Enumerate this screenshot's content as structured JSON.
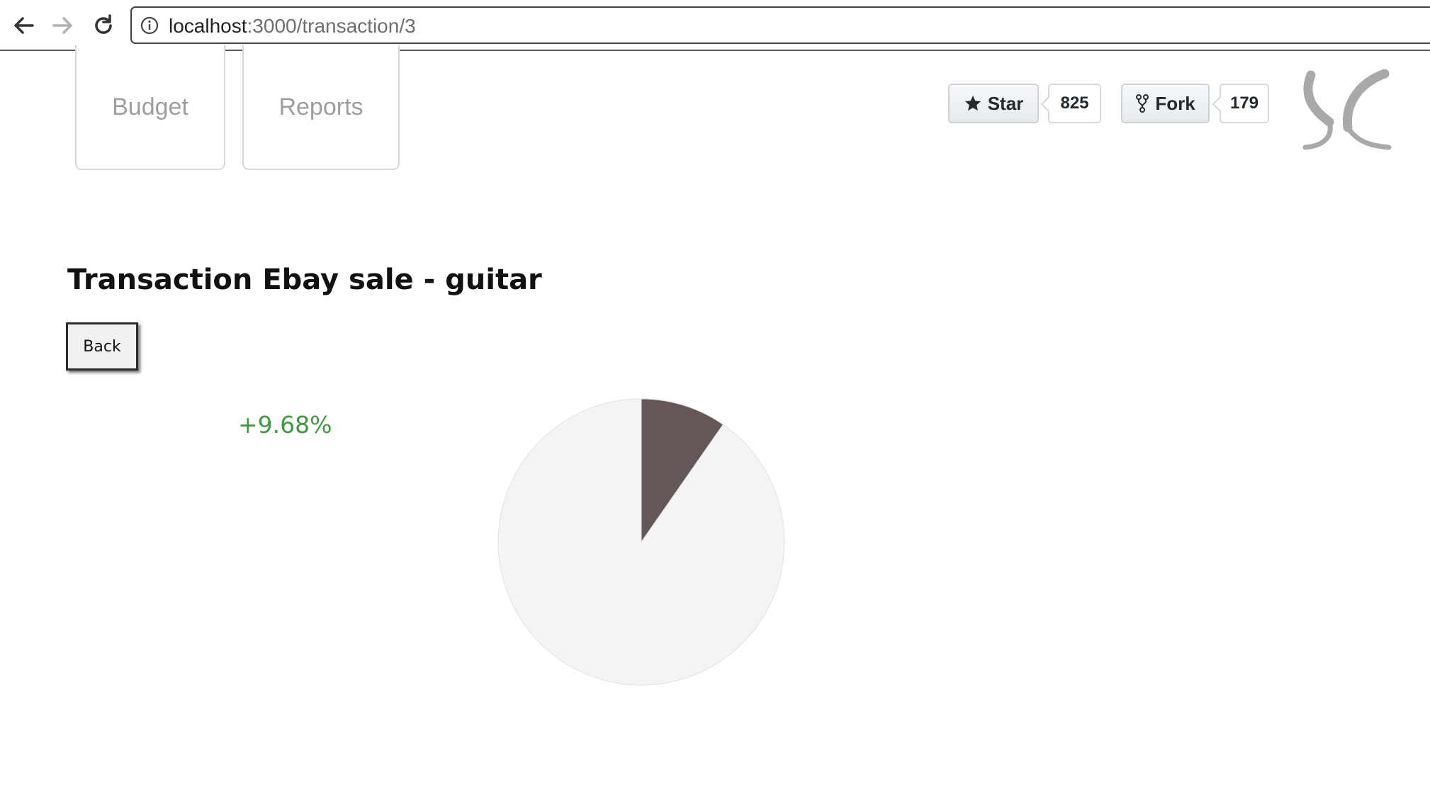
{
  "browser": {
    "url_host": "localhost",
    "url_path": ":3000/transaction/3"
  },
  "nav": {
    "cards": [
      {
        "label": "Budget"
      },
      {
        "label": "Reports"
      }
    ]
  },
  "github": {
    "star_label": "Star",
    "star_count": "825",
    "fork_label": "Fork",
    "fork_count": "179"
  },
  "page": {
    "title": "Transaction Ebay sale - guitar",
    "back_label": "Back",
    "percent_change": "+9.68%",
    "percent_color": "#3e9a3e"
  },
  "colors": {
    "slice_highlight": "#655757",
    "slice_rest": "#f4f4f4"
  },
  "chart_data": {
    "type": "pie",
    "slices": [
      {
        "value": 9.68,
        "color": "#655757"
      },
      {
        "value": 90.32,
        "color": "#f4f4f4"
      }
    ]
  }
}
